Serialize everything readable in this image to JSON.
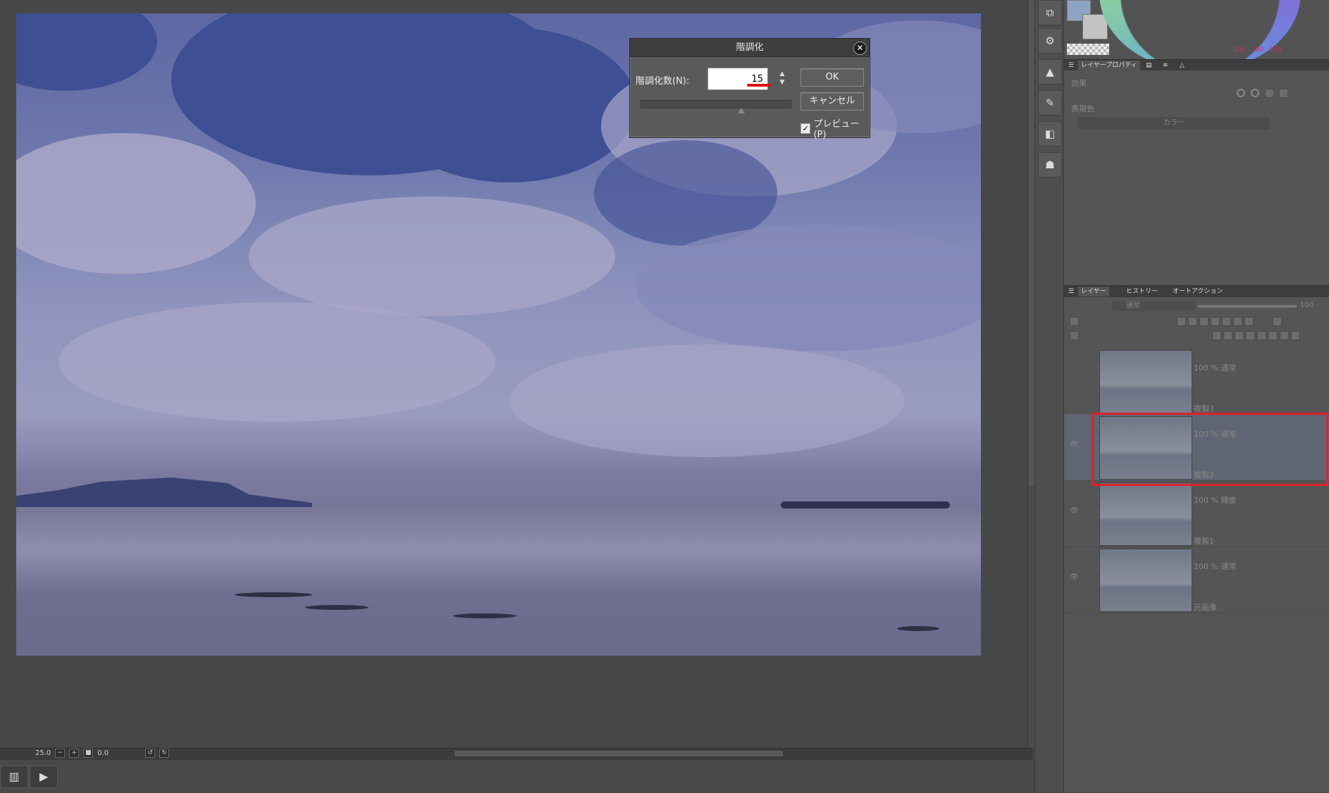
{
  "canvas": {
    "zoom_label": "25.0",
    "rotation_label": "0.0"
  },
  "posterize_dialog": {
    "title": "階調化",
    "levels_label": "階調化数(N):",
    "levels_value": "15",
    "ok_label": "OK",
    "cancel_label": "キャンセル",
    "preview_label": "プレビュー(P)",
    "preview_checked": true
  },
  "color_panel": {
    "main_color": "#8ea4c2",
    "sub_color": "#c3c3c3",
    "values": [
      "105",
      "100",
      "255"
    ]
  },
  "layer_property_panel": {
    "tabs": [
      "レイヤープロパティ"
    ],
    "effect_label": "効果",
    "expression_color_label": "表現色",
    "expression_color_value": "カラー"
  },
  "layer_panel": {
    "tabs": [
      "レイヤー",
      "ヒストリー",
      "オートアクション"
    ],
    "blend_mode": "通常",
    "opacity_value": "100",
    "layers": [
      {
        "mode": "100 % 通常",
        "name": "複製3",
        "selected": false
      },
      {
        "mode": "100 % 通常",
        "name": "複製2",
        "selected": true
      },
      {
        "mode": "100 % 輝度",
        "name": "複製1",
        "selected": false
      },
      {
        "mode": "100 % 通常",
        "name": "元画像",
        "selected": false
      }
    ]
  },
  "highlight_color": "#e0202a"
}
